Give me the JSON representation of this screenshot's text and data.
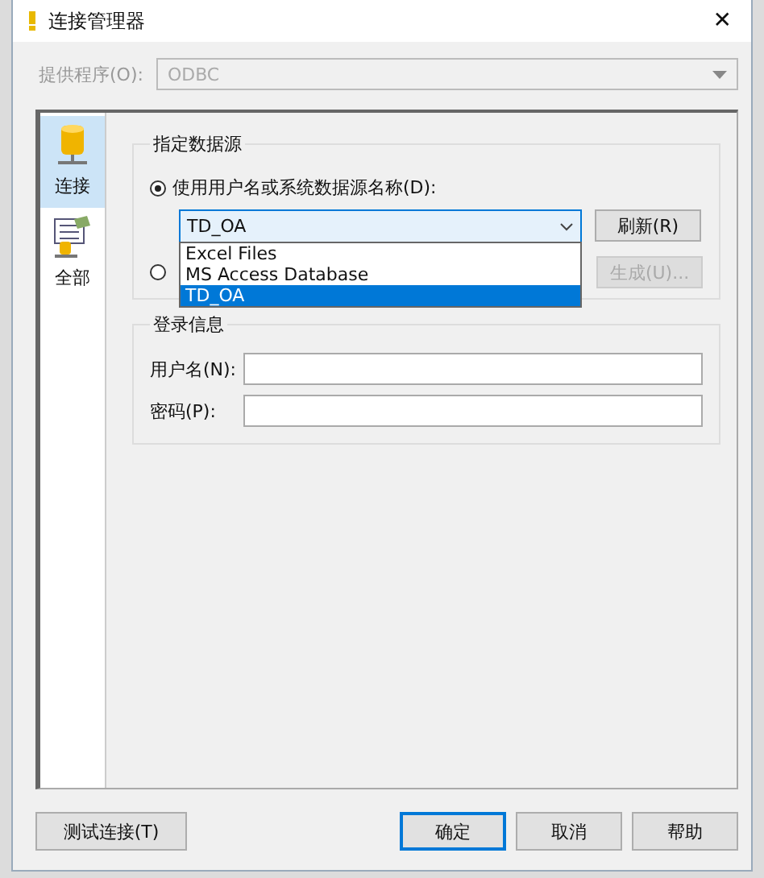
{
  "window": {
    "title": "连接管理器",
    "close": "✕"
  },
  "provider": {
    "label": "提供程序(O):",
    "value": "ODBC",
    "disabled": true
  },
  "sidebar": {
    "items": [
      {
        "label": "连接",
        "kind": "db",
        "selected": true
      },
      {
        "label": "全部",
        "kind": "all",
        "selected": false
      }
    ]
  },
  "data_source": {
    "title": "指定数据源",
    "options": [
      {
        "label": "使用用户名或系统数据源名称(D):",
        "selected": true
      },
      {
        "selected": false
      }
    ],
    "combo": {
      "value": "TD_OA",
      "expanded": true,
      "items": [
        {
          "label": "Excel Files",
          "selected": false
        },
        {
          "label": "MS Access Database",
          "selected": false
        },
        {
          "label": "TD_OA",
          "selected": true
        }
      ]
    },
    "refresh": {
      "label": "刷新(R)",
      "disabled": false
    },
    "build": {
      "label": "生成(U)...",
      "disabled": true
    }
  },
  "login": {
    "title": "登录信息",
    "fields": [
      {
        "label": "用户名(N):"
      },
      {
        "label": "密码(P):"
      }
    ]
  },
  "buttons": [
    {
      "label": "测试连接(T)",
      "kind": "left",
      "default": false
    },
    {
      "label": "确定",
      "kind": "right",
      "default": true
    },
    {
      "label": "取消",
      "kind": "right",
      "default": false
    },
    {
      "label": "帮助",
      "kind": "right",
      "default": false
    }
  ]
}
